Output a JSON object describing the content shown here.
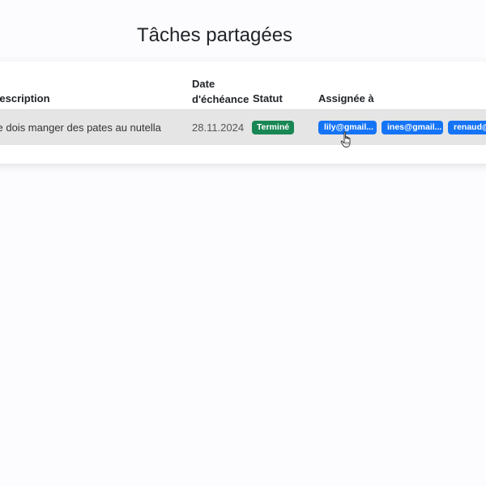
{
  "page": {
    "title": "Tâches partagées"
  },
  "table": {
    "headers": {
      "description": "Description",
      "due_date": "Date d'échéance",
      "status": "Statut",
      "assigned_to": "Assignée à"
    },
    "rows": [
      {
        "description": "Je dois manger des pates au nutella",
        "due_date": "28.11.2024",
        "status": "Terminé",
        "assignees": [
          "lily@gmail...",
          "ines@gmail...",
          "renaud@gmail..."
        ]
      }
    ]
  },
  "colors": {
    "status_done": "#198754",
    "assignee_badge": "#1574f6",
    "row_highlight": "#e5e5e5"
  },
  "icons": {
    "cursor": "hand-pointer-icon"
  }
}
